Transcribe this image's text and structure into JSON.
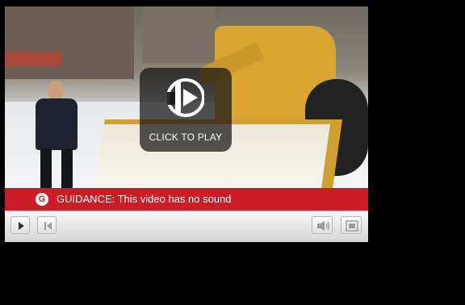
{
  "player": {
    "overlay_label": "CLICK TO PLAY",
    "guidance_badge": "G",
    "guidance_text": "GUIDANCE:  This video has no sound"
  },
  "controls": {
    "icons": [
      "play-icon",
      "skip-back-icon",
      "volume-icon",
      "fullscreen-icon"
    ]
  },
  "colors": {
    "guidance_bar": "#cc1c26",
    "overlay": "#141414",
    "control_bar": "#e4e4e4"
  }
}
